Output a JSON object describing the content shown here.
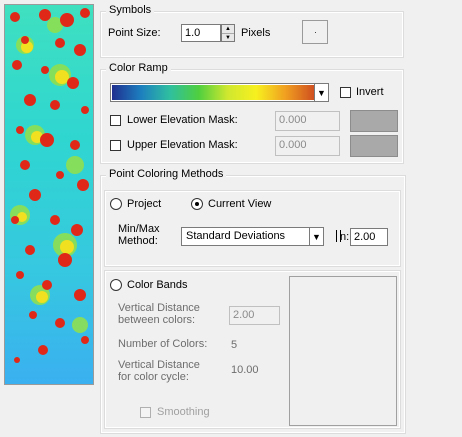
{
  "symbols": {
    "title": "Symbols",
    "point_size_label": "Point Size:",
    "point_size_value": "1.0",
    "pixels_label": "Pixels"
  },
  "color_ramp": {
    "title": "Color Ramp",
    "invert_label": "Invert",
    "lower_mask_label": "Lower Elevation Mask:",
    "lower_mask_value": "0.000",
    "upper_mask_label": "Upper Elevation Mask:",
    "upper_mask_value": "0.000",
    "ramp_colors": [
      "#1f2f8f",
      "#1d7fbf",
      "#2fbfa0",
      "#4fcf3f",
      "#cfe82f",
      "#f7f01f",
      "#f0a020",
      "#d05020"
    ]
  },
  "point_coloring": {
    "title": "Point Coloring Methods",
    "project_label": "Project",
    "current_view_label": "Current View",
    "minmax_label_line1": "Min/Max",
    "minmax_label_line2": "Method:",
    "method_value": "Standard Deviations",
    "n_label": "n:",
    "n_value": "2.00",
    "color_bands_label": "Color Bands",
    "vert_dist_label_1": "Vertical Distance",
    "vert_dist_label_2": "between colors:",
    "vert_dist_value": "2.00",
    "num_colors_label": "Number of Colors:",
    "num_colors_value": "5",
    "cycle_label_1": "Vertical Distance",
    "cycle_label_2": "for color cycle:",
    "cycle_value": "10.00",
    "smoothing_label": "Smoothing"
  }
}
